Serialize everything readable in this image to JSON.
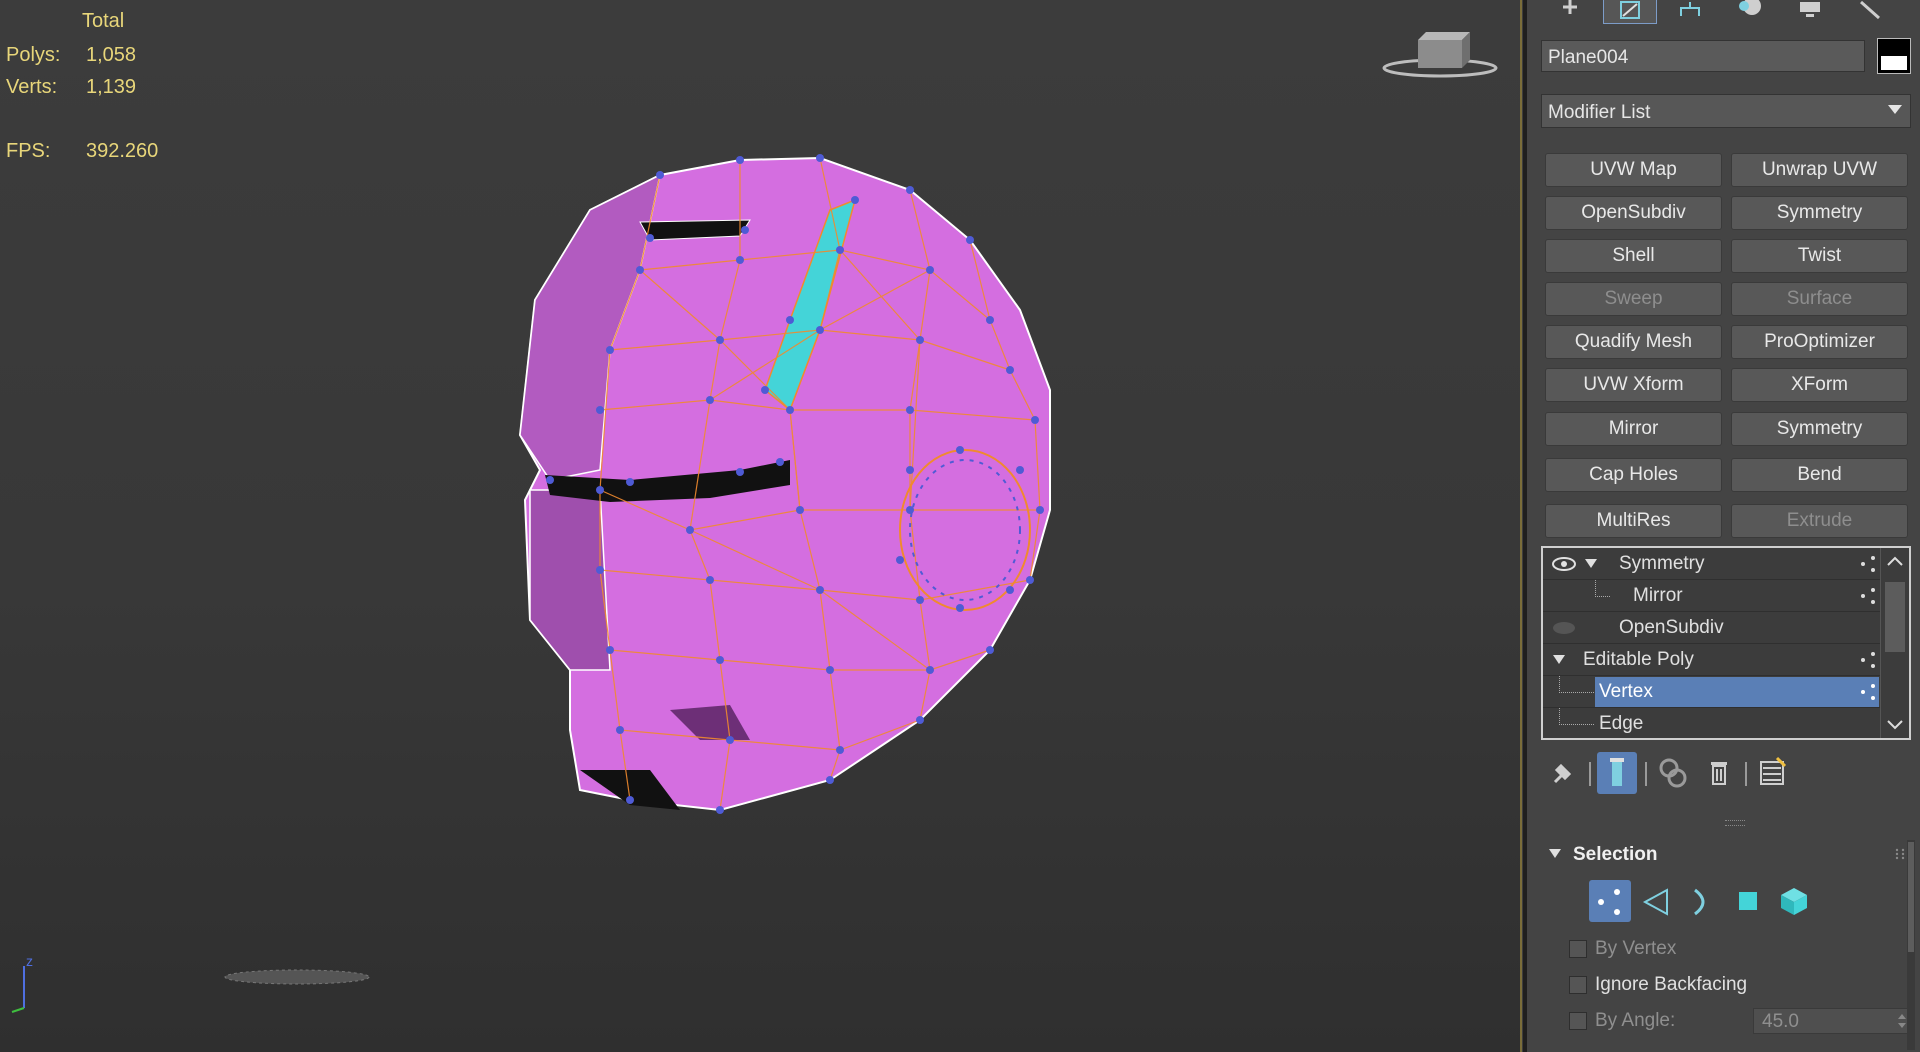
{
  "viewport": {
    "stats": {
      "header": "Total",
      "polys_label": "Polys:",
      "polys_value": "1,058",
      "verts_label": "Verts:",
      "verts_value": "1,139",
      "fps_label": "FPS:",
      "fps_value": "392.260"
    },
    "axis_label": "z",
    "colors": {
      "mesh_fill": "#d46ee0",
      "vertex": "#4f5bd5",
      "edge_highlight": "#f08a2e",
      "selected_face": "#44d4d8",
      "stats_text": "#e8d67a"
    }
  },
  "panel": {
    "tabs": [
      "create-icon",
      "modify-icon",
      "hierarchy-icon",
      "motion-icon",
      "display-icon",
      "utilities-icon"
    ],
    "object_name": "Plane004",
    "modifier_list_label": "Modifier List",
    "modifier_buttons": [
      {
        "label": "UVW Map",
        "enabled": true
      },
      {
        "label": "Unwrap UVW",
        "enabled": true
      },
      {
        "label": "OpenSubdiv",
        "enabled": true
      },
      {
        "label": "Symmetry",
        "enabled": true
      },
      {
        "label": "Shell",
        "enabled": true
      },
      {
        "label": "Twist",
        "enabled": true
      },
      {
        "label": "Sweep",
        "enabled": false
      },
      {
        "label": "Surface",
        "enabled": false
      },
      {
        "label": "Quadify Mesh",
        "enabled": true
      },
      {
        "label": "ProOptimizer",
        "enabled": true
      },
      {
        "label": "UVW Xform",
        "enabled": true
      },
      {
        "label": "XForm",
        "enabled": true
      },
      {
        "label": "Mirror",
        "enabled": true
      },
      {
        "label": "Symmetry",
        "enabled": true
      },
      {
        "label": "Cap Holes",
        "enabled": true
      },
      {
        "label": "Bend",
        "enabled": true
      },
      {
        "label": "MultiRes",
        "enabled": true
      },
      {
        "label": "Extrude",
        "enabled": false
      }
    ],
    "stack": {
      "symmetry": "Symmetry",
      "mirror": "Mirror",
      "opensubdiv": "OpenSubdiv",
      "editable_poly": "Editable Poly",
      "vertex": "Vertex",
      "edge": "Edge"
    },
    "selection": {
      "title": "Selection",
      "by_vertex": "By Vertex",
      "ignore_backfacing": "Ignore Backfacing",
      "by_angle": "By Angle:",
      "angle_value": "45.0"
    },
    "accent": "#5a7fb6"
  }
}
